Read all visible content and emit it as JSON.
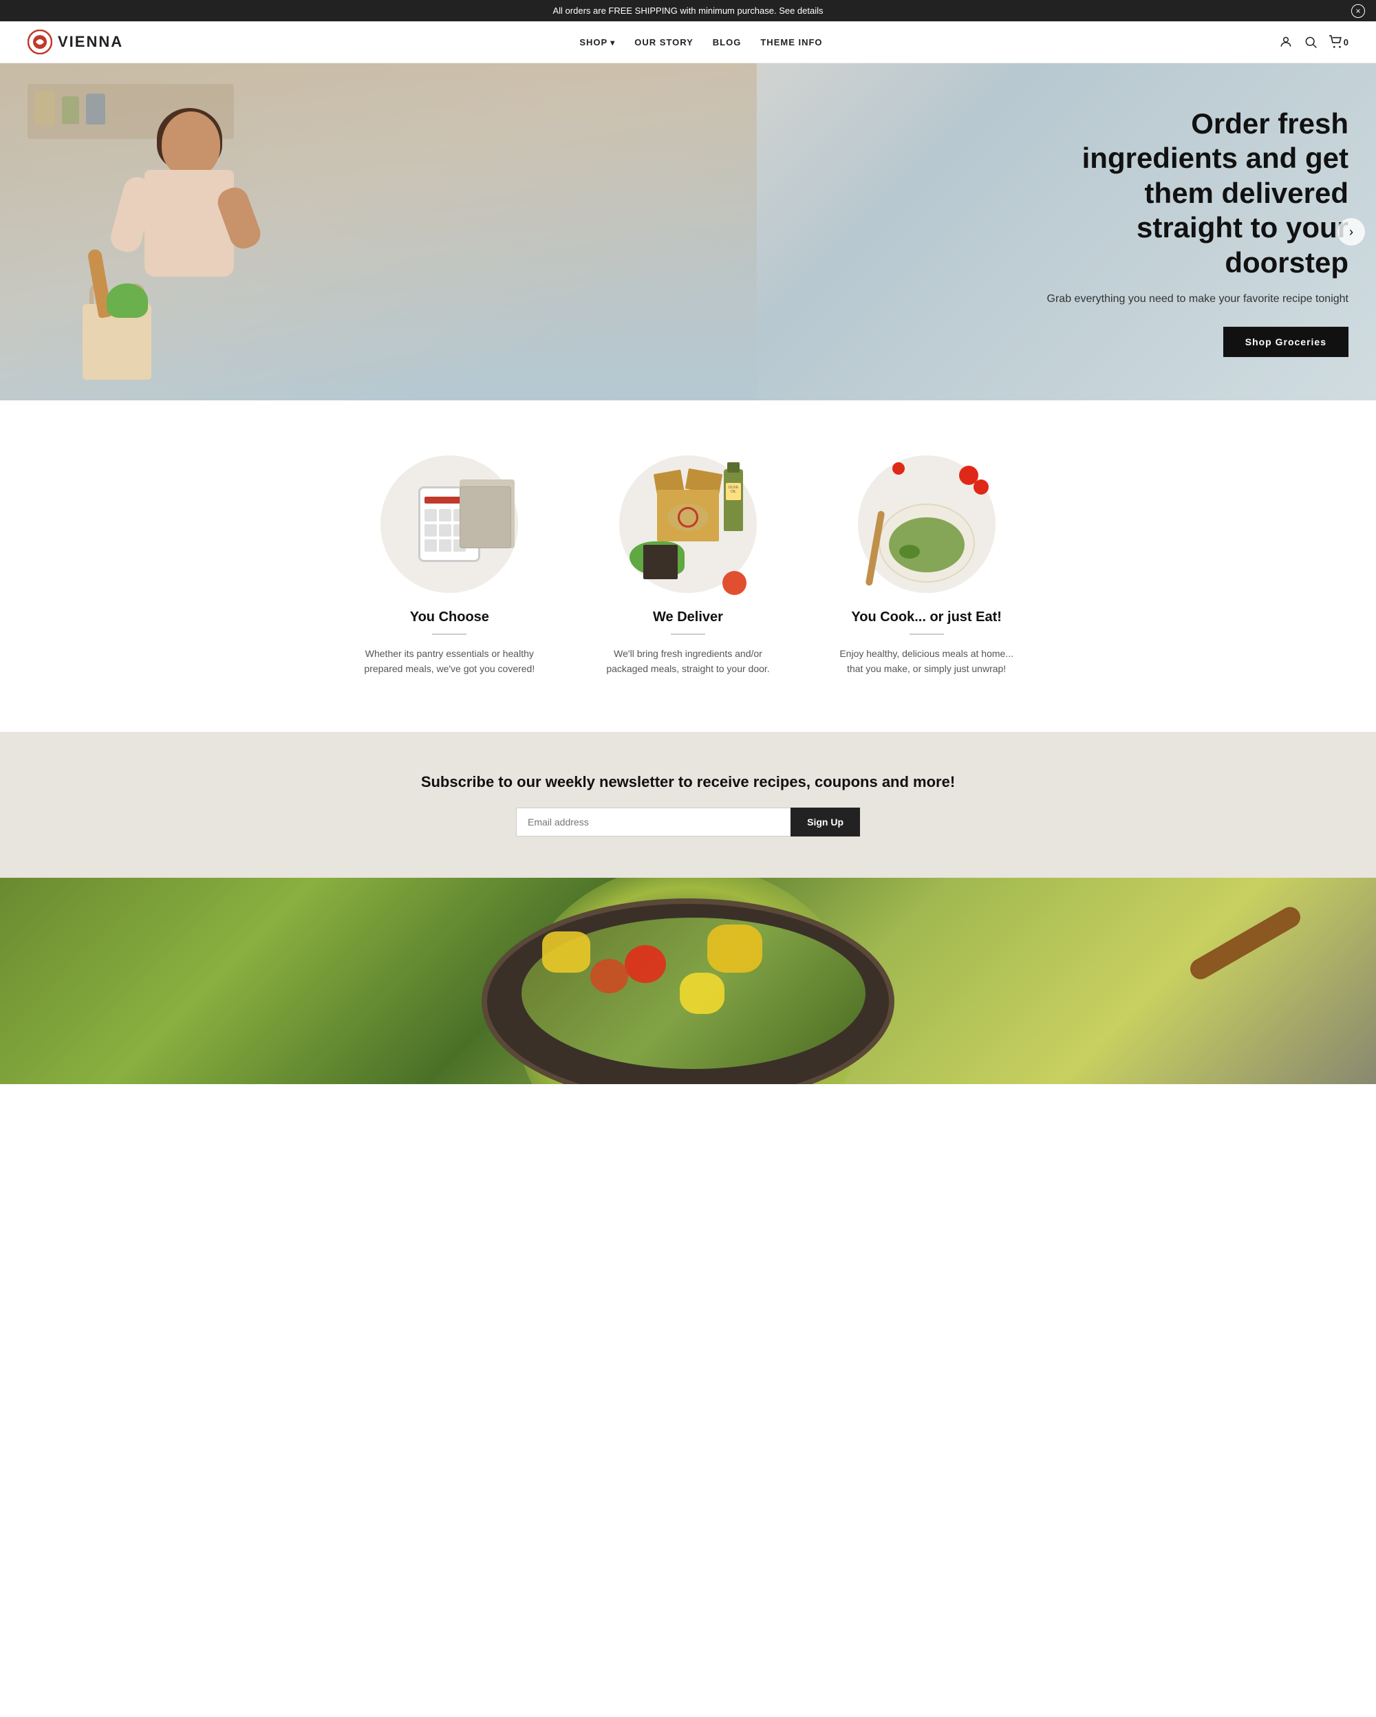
{
  "announcement": {
    "text": "All orders are FREE SHIPPING with minimum purchase. See details",
    "close_label": "×"
  },
  "header": {
    "logo_text": "VIENNA",
    "nav_items": [
      {
        "label": "SHOP",
        "has_dropdown": true
      },
      {
        "label": "OUR STORY",
        "has_dropdown": false
      },
      {
        "label": "BLOG",
        "has_dropdown": false
      },
      {
        "label": "THEME INFO",
        "has_dropdown": false
      }
    ],
    "cart_count": "0"
  },
  "hero": {
    "title": "Order fresh ingredients and get them delivered straight to your doorstep",
    "subtitle": "Grab everything you need to make your favorite recipe tonight",
    "cta_label": "Shop Groceries"
  },
  "features": {
    "items": [
      {
        "title": "You Choose",
        "description": "Whether its pantry essentials or healthy prepared meals, we've got you covered!"
      },
      {
        "title": "We Deliver",
        "description": "We'll bring fresh ingredients and/or packaged meals, straight to your door."
      },
      {
        "title": "You Cook... or just Eat!",
        "description": "Enjoy healthy, delicious meals at home... that you make, or simply just unwrap!"
      }
    ]
  },
  "newsletter": {
    "title": "Subscribe to our weekly newsletter to receive recipes, coupons and more!",
    "input_placeholder": "Email address",
    "button_label": "Sign Up"
  }
}
